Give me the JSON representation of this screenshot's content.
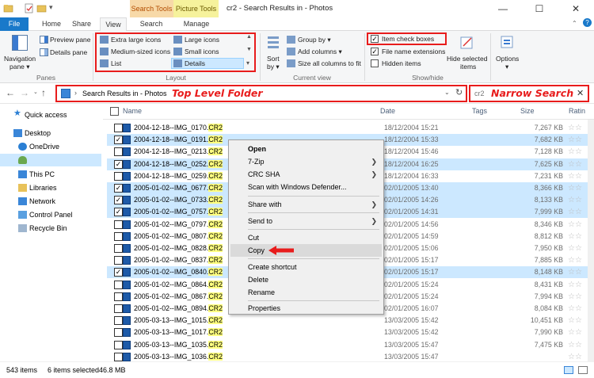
{
  "titlebar": {
    "contextual_tabs": [
      "Search Tools",
      "Picture Tools"
    ],
    "title": "cr2 - Search Results in - Photos",
    "controls": [
      "—",
      "☐",
      "✕"
    ]
  },
  "tabs": {
    "file": "File",
    "home": "Home",
    "share": "Share",
    "view": "View",
    "search": "Search",
    "manage": "Manage"
  },
  "ribbon": {
    "panes": {
      "navigation_pane": "Navigation pane",
      "navigation_pane_1": "Navigation",
      "navigation_pane_2": "pane ▾",
      "preview_pane": "Preview pane",
      "details_pane": "Details pane",
      "group_label": "Panes"
    },
    "layout": {
      "extra_large": "Extra large icons",
      "large": "Large icons",
      "medium": "Medium-sized icons",
      "small": "Small icons",
      "list": "List",
      "details": "Details",
      "group_label": "Layout"
    },
    "current_view": {
      "sort_1": "Sort",
      "sort_2": "by ▾",
      "group_by": "Group by ▾",
      "add_columns": "Add columns ▾",
      "size_all_columns": "Size all columns to fit",
      "group_label": "Current view"
    },
    "show_hide": {
      "item_check_boxes": "Item check boxes",
      "file_name_extensions": "File name extensions",
      "hidden_items": "Hidden items",
      "hide_selected_1": "Hide selected",
      "hide_selected_2": "items",
      "group_label": "Show/hide"
    },
    "options": {
      "label": "Options",
      "arrow": "▾"
    }
  },
  "address": {
    "path": "Search Results in - Photos",
    "search_value": "cr2",
    "annotation_folder": "Top Level Folder",
    "annotation_search": "Narrow Search"
  },
  "nav": {
    "quick_access": "Quick access",
    "desktop": "Desktop",
    "onedrive": "OneDrive",
    "this_pc": "This PC",
    "libraries": "Libraries",
    "network": "Network",
    "control_panel": "Control Panel",
    "recycle_bin": "Recycle Bin"
  },
  "columns": {
    "name": "Name",
    "date": "Date",
    "tags": "Tags",
    "size": "Size",
    "rating": "Ratin"
  },
  "files": [
    {
      "name": "2004-12-18--IMG_0170.",
      "ext": "CR2",
      "date": "18/12/2004 15:21",
      "size": "7,267 KB",
      "selected": false
    },
    {
      "name": "2004-12-18--IMG_0191.",
      "ext": "CR2",
      "date": "18/12/2004 15:33",
      "size": "7,682 KB",
      "selected": true
    },
    {
      "name": "2004-12-18--IMG_0213.",
      "ext": "CR2",
      "date": "18/12/2004 15:46",
      "size": "7,128 KB",
      "selected": false
    },
    {
      "name": "2004-12-18--IMG_0252.",
      "ext": "CR2",
      "date": "18/12/2004 16:25",
      "size": "7,625 KB",
      "selected": true
    },
    {
      "name": "2004-12-18--IMG_0259.",
      "ext": "CR2",
      "date": "18/12/2004 16:33",
      "size": "7,231 KB",
      "selected": false
    },
    {
      "name": "2005-01-02--IMG_0677.",
      "ext": "CR2",
      "date": "02/01/2005 13:40",
      "size": "8,366 KB",
      "selected": true
    },
    {
      "name": "2005-01-02--IMG_0733.",
      "ext": "CR2",
      "date": "02/01/2005 14:26",
      "size": "8,133 KB",
      "selected": true
    },
    {
      "name": "2005-01-02--IMG_0757.",
      "ext": "CR2",
      "date": "02/01/2005 14:31",
      "size": "7,999 KB",
      "selected": true
    },
    {
      "name": "2005-01-02--IMG_0797.",
      "ext": "CR2",
      "date": "02/01/2005 14:56",
      "size": "8,346 KB",
      "selected": false
    },
    {
      "name": "2005-01-02--IMG_0807.",
      "ext": "CR2",
      "date": "02/01/2005 14:59",
      "size": "8,812 KB",
      "selected": false
    },
    {
      "name": "2005-01-02--IMG_0828.",
      "ext": "CR2",
      "date": "02/01/2005 15:06",
      "size": "7,950 KB",
      "selected": false
    },
    {
      "name": "2005-01-02--IMG_0837.",
      "ext": "CR2",
      "date": "02/01/2005 15:17",
      "size": "7,885 KB",
      "selected": false
    },
    {
      "name": "2005-01-02--IMG_0840.",
      "ext": "CR2",
      "date": "02/01/2005 15:17",
      "size": "8,148 KB",
      "selected": true
    },
    {
      "name": "2005-01-02--IMG_0864.",
      "ext": "CR2",
      "date": "02/01/2005 15:24",
      "size": "8,431 KB",
      "selected": false
    },
    {
      "name": "2005-01-02--IMG_0867.",
      "ext": "CR2",
      "date": "02/01/2005 15:24",
      "size": "7,994 KB",
      "selected": false
    },
    {
      "name": "2005-01-02--IMG_0894.",
      "ext": "CR2",
      "date": "02/01/2005 16:07",
      "size": "8,084 KB",
      "selected": false
    },
    {
      "name": "2005-03-13--IMG_1015.",
      "ext": "CR2",
      "date": "13/03/2005 15:42",
      "size": "10,451 KB",
      "selected": false
    },
    {
      "name": "2005-03-13--IMG_1017.",
      "ext": "CR2",
      "date": "13/03/2005 15:42",
      "size": "7,990 KB",
      "selected": false
    },
    {
      "name": "2005-03-13--IMG_1035.",
      "ext": "CR2",
      "date": "13/03/2005 15:47",
      "size": "7,475 KB",
      "selected": false
    },
    {
      "name": "2005-03-13--IMG_1036.",
      "ext": "CR2",
      "date": "13/03/2005 15:47",
      "size": "",
      "selected": false
    }
  ],
  "context_menu": {
    "open": "Open",
    "seven_zip": "7-Zip",
    "crc_sha": "CRC SHA",
    "defender": "Scan with Windows Defender...",
    "share_with": "Share with",
    "send_to": "Send to",
    "cut": "Cut",
    "copy": "Copy",
    "create_shortcut": "Create shortcut",
    "delete": "Delete",
    "rename": "Rename",
    "properties": "Properties"
  },
  "status": {
    "item_count": "543 items",
    "selection": "6 items selected",
    "size": "46.8 MB"
  },
  "colors": {
    "accent_blue": "#1979ca",
    "selection": "#cce8ff",
    "annotation_red": "#e81c1c",
    "search_tools_tab": "#f7d9a8",
    "picture_tools_tab": "#f6f29c"
  }
}
